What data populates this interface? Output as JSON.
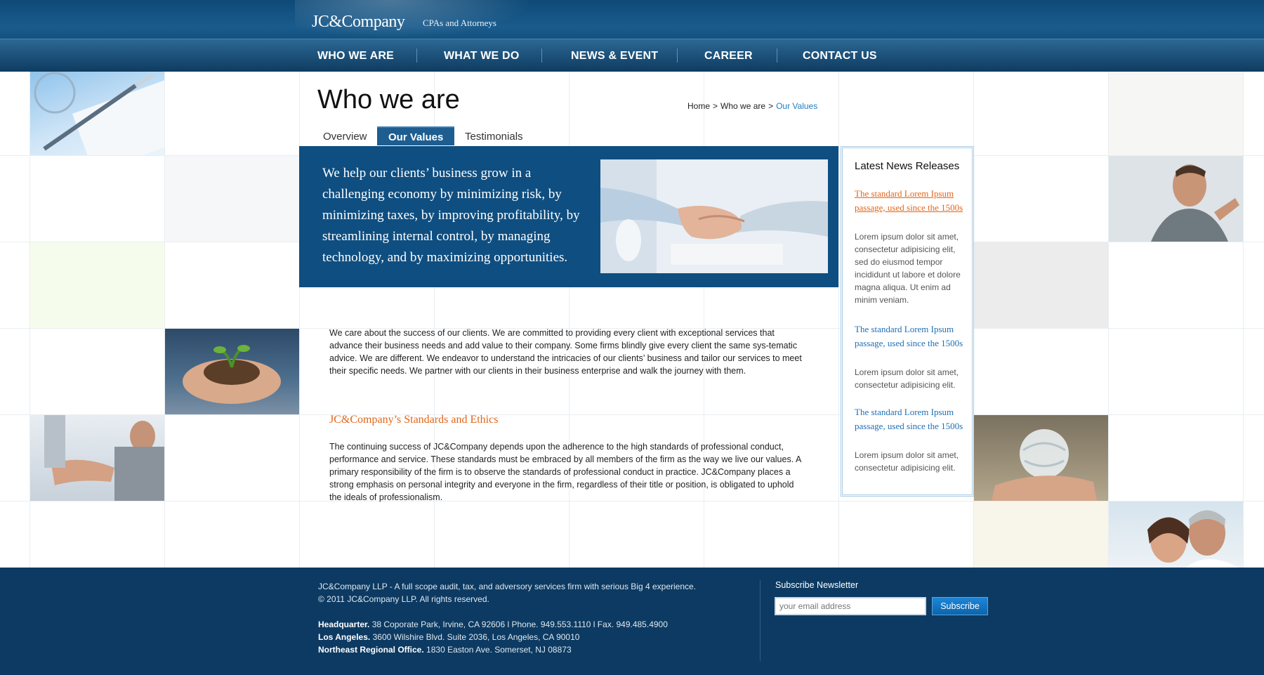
{
  "header": {
    "logo": "JC&Company",
    "tagline": "CPAs and Attorneys"
  },
  "nav": {
    "items": [
      {
        "label": "WHO WE ARE"
      },
      {
        "label": "WHAT WE DO"
      },
      {
        "label": "NEWS & EVENT"
      },
      {
        "label": "CAREER"
      },
      {
        "label": "CONTACT US"
      }
    ]
  },
  "page": {
    "title": "Who we are",
    "breadcrumb": [
      "Home",
      ">",
      "Who we are",
      ">",
      "Our Values"
    ]
  },
  "tabs": [
    {
      "label": "Overview",
      "active": false
    },
    {
      "label": "Our Values",
      "active": true
    },
    {
      "label": "Testimonials",
      "active": false
    }
  ],
  "hero": {
    "text": "We help our clients’ business grow in a challenging economy by minimizing risk, by minimizing taxes, by improving profitability, by streamlining internal control, by managing technology, and by maximizing opportunities."
  },
  "main": {
    "intro": "We care about the success of our clients. We are committed to providing every client with exceptional services that advance their business needs and add value to their company. Some firms blindly give every client the same sys-tematic advice. We are different. We endeavor to understand the intricacies of our clients’ business and tailor our services to meet their specific needs. We partner with our clients in their business enterprise and walk the journey with them.",
    "section_title": "JC&Company’s Standards and Ethics",
    "section_text": "The continuing success of JC&Company depends upon the adherence to the high standards of professional conduct, performance and service. These standards must be embraced by all members of the firm as the way we live our values. A primary responsibility of the firm is to observe the standards of professional conduct in practice. JC&Company places a strong emphasis on personal integrity and everyone in the firm, regardless of their title or position, is obligated to uphold the ideals of professionalism."
  },
  "sidebar": {
    "title": "Latest News Releases",
    "items": [
      {
        "title": "The standard Lorem Ipsum passage, used since the 1500s",
        "desc": "Lorem ipsum dolor sit amet, consectetur adipisicing elit, sed do eiusmod tempor incididunt ut labore et dolore magna aliqua. Ut enim ad minim veniam."
      },
      {
        "title": "The standard Lorem Ipsum passage, used since the 1500s",
        "desc": "Lorem ipsum dolor sit amet, consectetur adipisicing elit."
      },
      {
        "title": "The standard Lorem Ipsum passage, used since the 1500s",
        "desc": "Lorem ipsum dolor sit amet, consectetur adipisicing elit."
      }
    ]
  },
  "footer": {
    "about": "JC&Company LLP - A full scope audit, tax, and adversory services firm with serious Big 4 experience.",
    "copyright": "© 2011 JC&Company LLP.  All rights reserved.",
    "offices": [
      {
        "name": "Headquarter.",
        "address": "38 Coporate Park, Irvine, CA 92606  l  Phone. 949.553.1110  l  Fax. 949.485.4900"
      },
      {
        "name": "Los Angeles.",
        "address": "3600 Wilshire Blvd. Suite 2036, Los Angeles, CA 90010"
      },
      {
        "name": "Northeast Regional Office.",
        "address": "1830 Easton Ave. Somerset, NJ 08873"
      }
    ],
    "newsletter": {
      "title": "Subscribe Newsletter",
      "placeholder": "your email address",
      "button": "Subscribe"
    }
  },
  "colors": {
    "brand_blue": "#0f4e80",
    "accent_orange": "#e0661a",
    "link_blue": "#1f6fb5",
    "footer_bg": "#0c3a62"
  }
}
